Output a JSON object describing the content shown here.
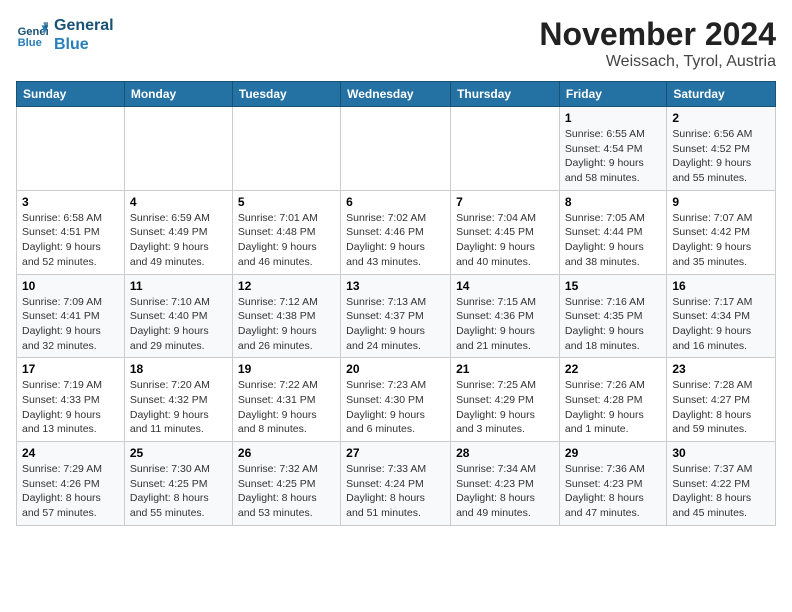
{
  "logo": {
    "line1": "General",
    "line2": "Blue"
  },
  "title": "November 2024",
  "subtitle": "Weissach, Tyrol, Austria",
  "days_of_week": [
    "Sunday",
    "Monday",
    "Tuesday",
    "Wednesday",
    "Thursday",
    "Friday",
    "Saturday"
  ],
  "weeks": [
    [
      {
        "day": "",
        "info": ""
      },
      {
        "day": "",
        "info": ""
      },
      {
        "day": "",
        "info": ""
      },
      {
        "day": "",
        "info": ""
      },
      {
        "day": "",
        "info": ""
      },
      {
        "day": "1",
        "info": "Sunrise: 6:55 AM\nSunset: 4:54 PM\nDaylight: 9 hours and 58 minutes."
      },
      {
        "day": "2",
        "info": "Sunrise: 6:56 AM\nSunset: 4:52 PM\nDaylight: 9 hours and 55 minutes."
      }
    ],
    [
      {
        "day": "3",
        "info": "Sunrise: 6:58 AM\nSunset: 4:51 PM\nDaylight: 9 hours and 52 minutes."
      },
      {
        "day": "4",
        "info": "Sunrise: 6:59 AM\nSunset: 4:49 PM\nDaylight: 9 hours and 49 minutes."
      },
      {
        "day": "5",
        "info": "Sunrise: 7:01 AM\nSunset: 4:48 PM\nDaylight: 9 hours and 46 minutes."
      },
      {
        "day": "6",
        "info": "Sunrise: 7:02 AM\nSunset: 4:46 PM\nDaylight: 9 hours and 43 minutes."
      },
      {
        "day": "7",
        "info": "Sunrise: 7:04 AM\nSunset: 4:45 PM\nDaylight: 9 hours and 40 minutes."
      },
      {
        "day": "8",
        "info": "Sunrise: 7:05 AM\nSunset: 4:44 PM\nDaylight: 9 hours and 38 minutes."
      },
      {
        "day": "9",
        "info": "Sunrise: 7:07 AM\nSunset: 4:42 PM\nDaylight: 9 hours and 35 minutes."
      }
    ],
    [
      {
        "day": "10",
        "info": "Sunrise: 7:09 AM\nSunset: 4:41 PM\nDaylight: 9 hours and 32 minutes."
      },
      {
        "day": "11",
        "info": "Sunrise: 7:10 AM\nSunset: 4:40 PM\nDaylight: 9 hours and 29 minutes."
      },
      {
        "day": "12",
        "info": "Sunrise: 7:12 AM\nSunset: 4:38 PM\nDaylight: 9 hours and 26 minutes."
      },
      {
        "day": "13",
        "info": "Sunrise: 7:13 AM\nSunset: 4:37 PM\nDaylight: 9 hours and 24 minutes."
      },
      {
        "day": "14",
        "info": "Sunrise: 7:15 AM\nSunset: 4:36 PM\nDaylight: 9 hours and 21 minutes."
      },
      {
        "day": "15",
        "info": "Sunrise: 7:16 AM\nSunset: 4:35 PM\nDaylight: 9 hours and 18 minutes."
      },
      {
        "day": "16",
        "info": "Sunrise: 7:17 AM\nSunset: 4:34 PM\nDaylight: 9 hours and 16 minutes."
      }
    ],
    [
      {
        "day": "17",
        "info": "Sunrise: 7:19 AM\nSunset: 4:33 PM\nDaylight: 9 hours and 13 minutes."
      },
      {
        "day": "18",
        "info": "Sunrise: 7:20 AM\nSunset: 4:32 PM\nDaylight: 9 hours and 11 minutes."
      },
      {
        "day": "19",
        "info": "Sunrise: 7:22 AM\nSunset: 4:31 PM\nDaylight: 9 hours and 8 minutes."
      },
      {
        "day": "20",
        "info": "Sunrise: 7:23 AM\nSunset: 4:30 PM\nDaylight: 9 hours and 6 minutes."
      },
      {
        "day": "21",
        "info": "Sunrise: 7:25 AM\nSunset: 4:29 PM\nDaylight: 9 hours and 3 minutes."
      },
      {
        "day": "22",
        "info": "Sunrise: 7:26 AM\nSunset: 4:28 PM\nDaylight: 9 hours and 1 minute."
      },
      {
        "day": "23",
        "info": "Sunrise: 7:28 AM\nSunset: 4:27 PM\nDaylight: 8 hours and 59 minutes."
      }
    ],
    [
      {
        "day": "24",
        "info": "Sunrise: 7:29 AM\nSunset: 4:26 PM\nDaylight: 8 hours and 57 minutes."
      },
      {
        "day": "25",
        "info": "Sunrise: 7:30 AM\nSunset: 4:25 PM\nDaylight: 8 hours and 55 minutes."
      },
      {
        "day": "26",
        "info": "Sunrise: 7:32 AM\nSunset: 4:25 PM\nDaylight: 8 hours and 53 minutes."
      },
      {
        "day": "27",
        "info": "Sunrise: 7:33 AM\nSunset: 4:24 PM\nDaylight: 8 hours and 51 minutes."
      },
      {
        "day": "28",
        "info": "Sunrise: 7:34 AM\nSunset: 4:23 PM\nDaylight: 8 hours and 49 minutes."
      },
      {
        "day": "29",
        "info": "Sunrise: 7:36 AM\nSunset: 4:23 PM\nDaylight: 8 hours and 47 minutes."
      },
      {
        "day": "30",
        "info": "Sunrise: 7:37 AM\nSunset: 4:22 PM\nDaylight: 8 hours and 45 minutes."
      }
    ]
  ]
}
